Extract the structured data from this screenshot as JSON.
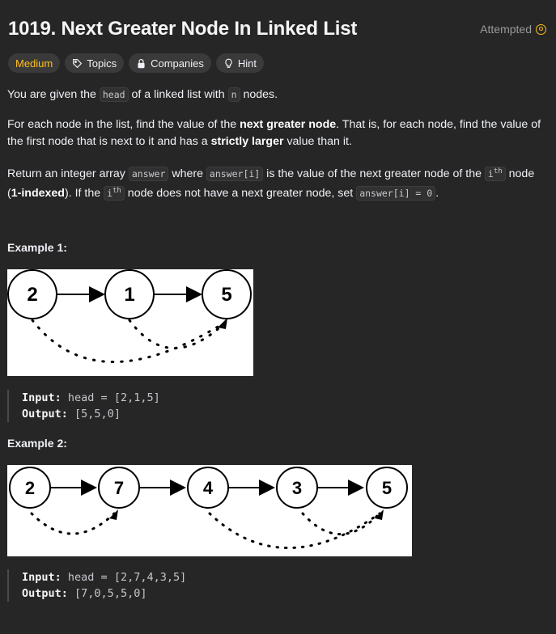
{
  "problem": {
    "title": "1019. Next Greater Node In Linked List",
    "status": "Attempted"
  },
  "tags": {
    "difficulty": "Medium",
    "topics": "Topics",
    "companies": "Companies",
    "hint": "Hint"
  },
  "description": {
    "p1_a": "You are given the ",
    "p1_code1": "head",
    "p1_b": " of a linked list with ",
    "p1_code2": "n",
    "p1_c": " nodes.",
    "p2_a": "For each node in the list, find the value of the ",
    "p2_bold1": "next greater node",
    "p2_b": ". That is, for each node, find the value of the first node that is next to it and has a ",
    "p2_bold2": "strictly larger",
    "p2_c": " value than it.",
    "p3_a": "Return an integer array ",
    "p3_code1": "answer",
    "p3_b": " where ",
    "p3_code2": "answer[i]",
    "p3_c": " is the value of the next greater node of the ",
    "p3_code3_base": "i",
    "p3_code3_sup": "th",
    "p3_d": " node (",
    "p3_bold": "1-indexed",
    "p3_e": "). If the ",
    "p3_code4_base": "i",
    "p3_code4_sup": "th",
    "p3_f": " node does not have a next greater node, set ",
    "p3_code5": "answer[i] = 0",
    "p3_g": "."
  },
  "examples": [
    {
      "title": "Example 1:",
      "nodes": [
        "2",
        "1",
        "5"
      ],
      "input_label": "Input:",
      "input_value": "head = [2,1,5]",
      "output_label": "Output:",
      "output_value": "[5,5,0]"
    },
    {
      "title": "Example 2:",
      "nodes": [
        "2",
        "7",
        "4",
        "3",
        "5"
      ],
      "input_label": "Input:",
      "input_value": "head = [2,7,4,3,5]",
      "output_label": "Output:",
      "output_value": "[7,0,5,5,0]"
    }
  ],
  "colors": {
    "background": "#262626",
    "difficulty_medium": "#ffc01e",
    "status_icon": "#ffc01e"
  }
}
